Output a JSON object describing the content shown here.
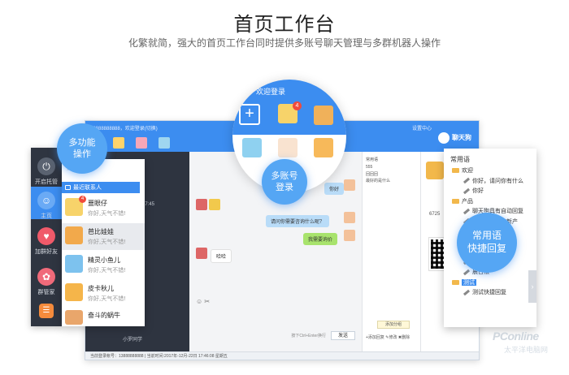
{
  "header": {
    "title": "首页工作台",
    "subtitle": "化繁就简，强大的首页工作台同时提供多账号聊天管理与多群机器人操作"
  },
  "callouts": {
    "multi_function_line1": "多功能",
    "multi_function_line2": "操作",
    "multi_account_line1": "多账号",
    "multi_account_line2": "登录",
    "quick_phrase_line1": "常用语",
    "quick_phrase_line2": "快捷回复"
  },
  "zoom_circle": {
    "welcome": "，欢迎登录",
    "plus": "+",
    "badge_count": "4"
  },
  "window": {
    "account_bar": "13888888888，欢迎登录(切换)",
    "settings": "设置中心",
    "logo_text": "聊天狗",
    "chat_bubbles": [
      {
        "text": "你好",
        "color": "blue"
      },
      {
        "text": "请问你需要咨询什么呢？",
        "color": "blue"
      },
      {
        "text": "我需要询价",
        "color": "green"
      },
      {
        "text": "哈哈",
        "color": "white"
      }
    ],
    "time_label": "17:45",
    "send_hint": "按下Ctrl+Enter换行",
    "send_button": "发送",
    "tree_header": "常用语",
    "tree_items": [
      "555",
      "回回回",
      "最好的是什么"
    ],
    "add_group_button": "添加分组",
    "tree_bottom": "+添加回复  ✎修改  ✖删除",
    "side_count": "6725",
    "status_bar": "当前登录帐号：13888888888  |  当前时间:2017年-12月-22日 17:46:08 星期五",
    "chat_row_name": "小罗同学"
  },
  "dock": {
    "items": [
      {
        "label": "开启托管",
        "icon": "power-icon"
      },
      {
        "label": "主页",
        "icon": "home-icon"
      },
      {
        "label": "加群好友",
        "icon": "add-friend-icon"
      },
      {
        "label": "群管家",
        "icon": "group-manager-icon"
      },
      {
        "label": "",
        "icon": "more-icon"
      }
    ]
  },
  "contacts": {
    "search_placeholder": "搜索联系人",
    "recent_label": "最近联系人",
    "items": [
      {
        "name": "噩眼仔",
        "message": "你好,天气不错!",
        "badge": "4"
      },
      {
        "name": "芭比娃娃",
        "message": "你好,天气不错!",
        "badge": ""
      },
      {
        "name": "精灵小鱼儿",
        "message": "你好,天气不错!",
        "badge": ""
      },
      {
        "name": "皮卡秋儿",
        "message": "你好,天气不错!",
        "badge": ""
      },
      {
        "name": "奋斗的蜗牛",
        "message": "",
        "badge": ""
      }
    ]
  },
  "phrases": {
    "title": "常用语",
    "items": [
      {
        "type": "folder",
        "text": "欢迎",
        "indent": 1
      },
      {
        "type": "phrase",
        "text": "你好，请问你有什么",
        "indent": 2
      },
      {
        "type": "phrase",
        "text": "你好",
        "indent": 2
      },
      {
        "type": "folder",
        "text": "产品",
        "indent": 1
      },
      {
        "type": "phrase",
        "text": "聊天狗具有自动回复",
        "indent": 2
      },
      {
        "type": "phrase",
        "text": "你好，聊天狗新产",
        "indent": 2
      },
      {
        "type": "phrase",
        "text": "适用",
        "indent": 2
      },
      {
        "type": "phrase",
        "text": "啊",
        "indent": 2
      },
      {
        "type": "phrase",
        "text": "喜迎元旦",
        "indent": 2
      },
      {
        "type": "phrase",
        "text": "期待你的尝试",
        "indent": 2
      },
      {
        "type": "phrase",
        "text": "晨日法",
        "indent": 2
      },
      {
        "type": "folder-selected",
        "text": "测试",
        "indent": 1
      },
      {
        "type": "phrase",
        "text": "测试快捷回复",
        "indent": 2
      }
    ]
  },
  "watermark": {
    "main": "PConline",
    "sub": "太平洋电脑网"
  },
  "colors": {
    "accent": "#3c8df0",
    "callout": "#55a6f4",
    "dark_panel": "#2f3541",
    "badge": "#f04b3c"
  }
}
